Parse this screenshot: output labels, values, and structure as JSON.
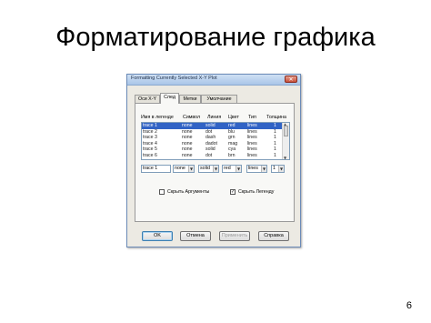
{
  "slide": {
    "title": "Форматирование графика",
    "page_number": "6"
  },
  "dialog": {
    "title": "Formatting Currently Selected X-Y Plot",
    "close_glyph": "✕",
    "tabs": [
      "Оси X-Y",
      "След",
      "Метки",
      "Умолчание"
    ],
    "active_tab": "След",
    "columns": [
      "Имя в легенде",
      "Символ",
      "Линия",
      "Цвет",
      "Тип",
      "Толщина"
    ],
    "traces": [
      {
        "name": "trace 1",
        "symbol": "none",
        "line": "solid",
        "color": "red",
        "type": "lines",
        "weight": "1"
      },
      {
        "name": "trace 2",
        "symbol": "none",
        "line": "dot",
        "color": "blu",
        "type": "lines",
        "weight": "1"
      },
      {
        "name": "trace 3",
        "symbol": "none",
        "line": "dash",
        "color": "grn",
        "type": "lines",
        "weight": "1"
      },
      {
        "name": "trace 4",
        "symbol": "none",
        "line": "dadot",
        "color": "mag",
        "type": "lines",
        "weight": "1"
      },
      {
        "name": "trace 5",
        "symbol": "none",
        "line": "solid",
        "color": "cya",
        "type": "lines",
        "weight": "1"
      },
      {
        "name": "trace 6",
        "symbol": "none",
        "line": "dot",
        "color": "brn",
        "type": "lines",
        "weight": "1"
      }
    ],
    "selected_trace_index": 0,
    "editor": {
      "name": "trace 1",
      "symbol": "none",
      "line": "solid",
      "color": "red",
      "type": "lines",
      "weight": "1"
    },
    "checkboxes": {
      "hide_arguments": {
        "label": "Скрыть Аргументы",
        "checked": false
      },
      "hide_legend": {
        "label": "Скрыть Легенду",
        "checked": true
      }
    },
    "buttons": {
      "ok": "OK",
      "cancel": "Отмена",
      "apply": "Применить",
      "help": "Справка"
    },
    "colors": {
      "selection": "#3163c5",
      "titlebar": "#a9c5e8",
      "dialog_bg": "#eceae3"
    }
  }
}
